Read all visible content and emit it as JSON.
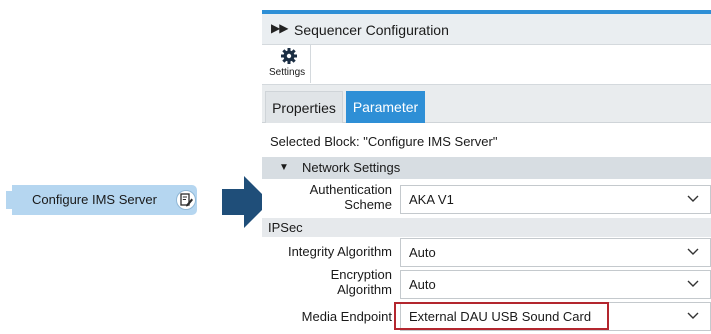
{
  "block": {
    "label": "Configure IMS Server",
    "icon": "edit-icon"
  },
  "panel": {
    "title": "Sequencer Configuration",
    "toolbar": {
      "settings_label": "Settings"
    },
    "tabs": [
      {
        "label": "Properties",
        "active": false
      },
      {
        "label": "Parameter",
        "active": true
      }
    ],
    "selected_block": "Selected Block: \"Configure IMS Server\"",
    "network_settings": {
      "title": "Network Settings",
      "authentication_scheme": {
        "label_line1": "Authentication",
        "label_line2": "Scheme",
        "value": "AKA V1"
      }
    },
    "ipsec": {
      "title": "IPSec",
      "integrity_algorithm": {
        "label": "Integrity Algorithm",
        "value": "Auto"
      },
      "encryption_algorithm": {
        "label_line1": "Encryption",
        "label_line2": "Algorithm",
        "value": "Auto"
      },
      "media_endpoint": {
        "label": "Media Endpoint",
        "value": "External DAU USB Sound Card"
      }
    }
  },
  "colors": {
    "accent": "#2e8fd6",
    "block": "#b5d6f0",
    "arrow": "#1f4e79",
    "highlight": "#b3262e"
  }
}
